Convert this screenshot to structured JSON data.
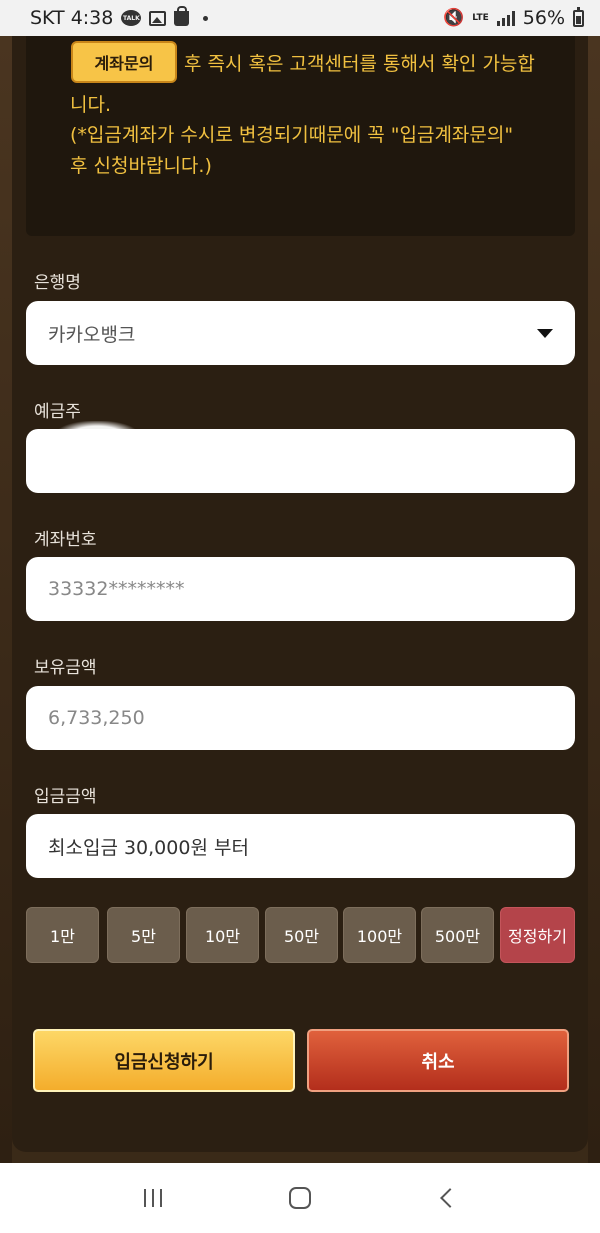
{
  "status_bar": {
    "carrier_time": "SKT 4:38",
    "talk_badge": "TALK",
    "network": "LTE",
    "battery": "56%"
  },
  "notice": {
    "inquiry_button": "계좌문의",
    "line1": "후 즉시 혹은 고객센터를 통해서 확인 가능합",
    "line2": "니다.",
    "line3": "(*입금계좌가 수시로 변경되기때문에 꼭 \"입금계좌문의\"",
    "line4": "후 신청바랍니다.)"
  },
  "form": {
    "bank_label": "은행명",
    "bank_value": "카카오뱅크",
    "holder_label": "예금주",
    "holder_value": "",
    "account_label": "계좌번호",
    "account_value": "33332********",
    "balance_label": "보유금액",
    "balance_value": "6,733,250",
    "amount_label": "입금금액",
    "amount_placeholder": "최소입금 30,000원 부터"
  },
  "quick_amounts": [
    "1만",
    "5만",
    "10만",
    "50만",
    "100만",
    "500만"
  ],
  "reset_label": "정정하기",
  "actions": {
    "submit_label": "입금신청하기",
    "cancel_label": "취소"
  },
  "colors": {
    "accent_gold": "#f7c447",
    "cancel_red": "#c23a22",
    "panel_bg": "#2b1f12"
  }
}
